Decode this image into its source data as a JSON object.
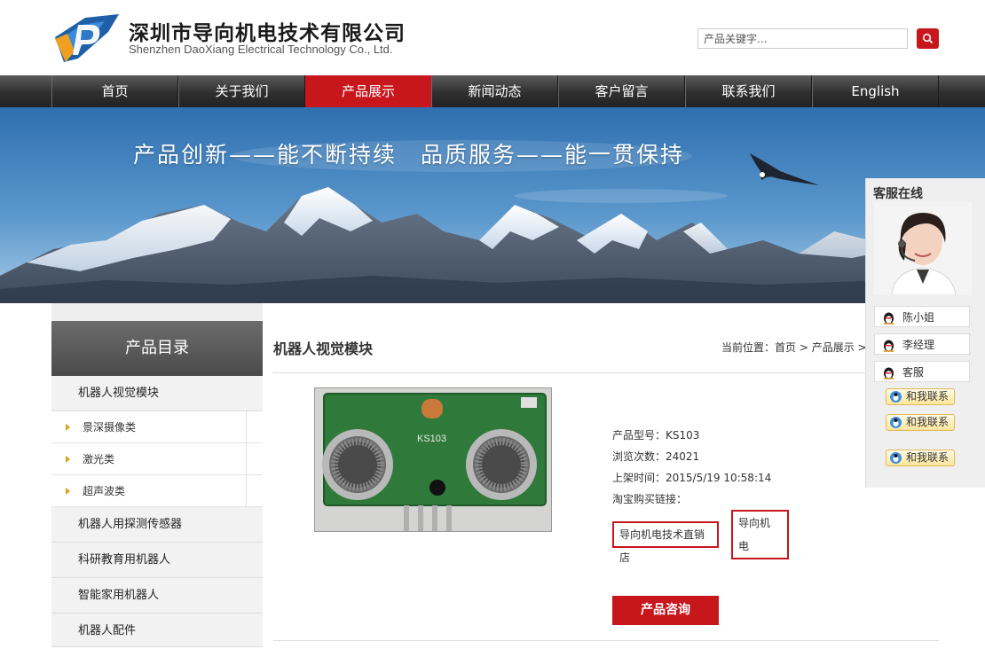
{
  "header": {
    "company_cn": "深圳市导向机电技术有限公司",
    "company_en": "Shenzhen DaoXiang Electrical Technology Co., Ltd.",
    "search_placeholder": "产品关键字...",
    "brand_color": "#c8161d"
  },
  "nav": {
    "items": [
      "首页",
      "关于我们",
      "产品展示",
      "新闻动态",
      "客户留言",
      "联系我们",
      "English"
    ],
    "active": "产品展示"
  },
  "banner": {
    "slogan": "产品创新——能不断持续　品质服务——能一贯保持"
  },
  "sidebar": {
    "title": "产品目录",
    "categories": [
      {
        "label": "机器人视觉模块"
      },
      {
        "label": "机器人用探测传感器"
      },
      {
        "label": "科研教育用机器人"
      },
      {
        "label": "智能家用机器人"
      },
      {
        "label": "机器人配件"
      }
    ],
    "subcategories": [
      "景深摄像类",
      "激光类",
      "超声波类"
    ]
  },
  "main": {
    "title": "机器人视觉模块",
    "breadcrumb": {
      "prefix": "当前位置：",
      "home": "首页",
      "sep1": " > ",
      "section": "产品展示",
      "sep2": " > "
    }
  },
  "product": {
    "model_label": "产品型号：",
    "model": "KS103",
    "views_label": "浏览次数：",
    "views": "24021",
    "date_label": "上架时间：",
    "date": "2015/5/19 10:58:14",
    "taobao_label": "淘宝购买链接：",
    "shop_link_1": "导向机电技术直销店",
    "shop_link_2a": "导向机",
    "shop_link_2b": "电",
    "consult_button": "产品咨询",
    "board_label": "KS103"
  },
  "customer_service": {
    "title": "客服在线",
    "people": [
      "陈小姐",
      "李经理",
      "客服"
    ],
    "contact_label": "和我联系"
  }
}
